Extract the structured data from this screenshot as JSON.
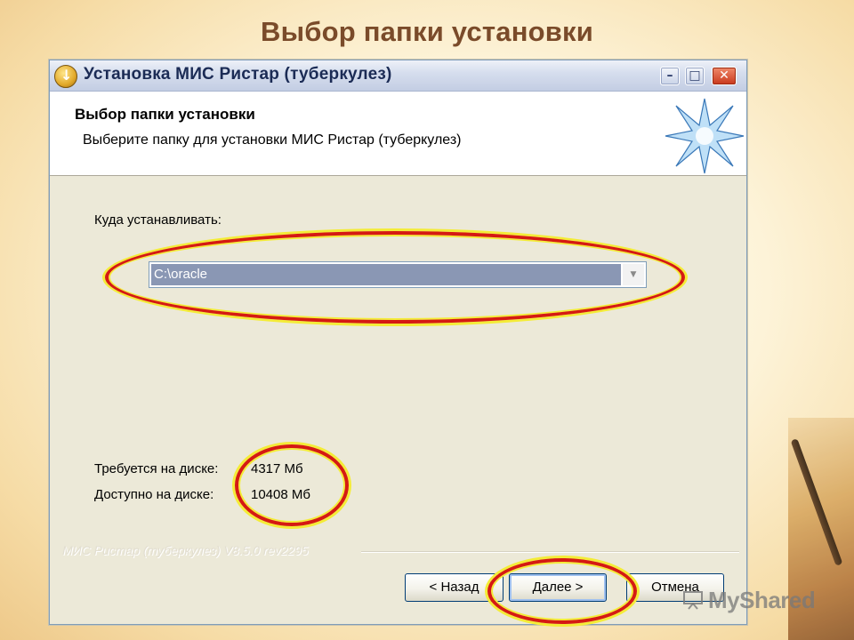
{
  "slide": {
    "title": "Выбор папки установки"
  },
  "window": {
    "title": "Установка МИС Ристар (туберкулез)",
    "controls": {
      "minimize": "–",
      "maximize": "□",
      "close": "✕"
    }
  },
  "header": {
    "title": "Выбор папки установки",
    "subtitle": "Выберите папку для установки МИС Ристар (туберкулез)",
    "logo_icon": "star-icon"
  },
  "destination": {
    "label": "Куда устанавливать:",
    "value": "C:\\oracle",
    "arrow_icon": "chevron-down-icon"
  },
  "disk": {
    "required_label": "Требуется на диске:",
    "required_value": "4317 Мб",
    "available_label": "Доступно на диске:",
    "available_value": "10408 Мб"
  },
  "version_text": "МИС Ристар (туберкулез) V8.5.0 rev2295",
  "buttons": {
    "back": "< Назад",
    "next": "Далее >",
    "cancel": "Отмена"
  },
  "watermark": "MyShared",
  "colors": {
    "title_brown": "#7a4b2a",
    "highlight_red": "#d51a12",
    "highlight_yellow": "#f4ec37",
    "combo_selection": "#8a97b4"
  }
}
